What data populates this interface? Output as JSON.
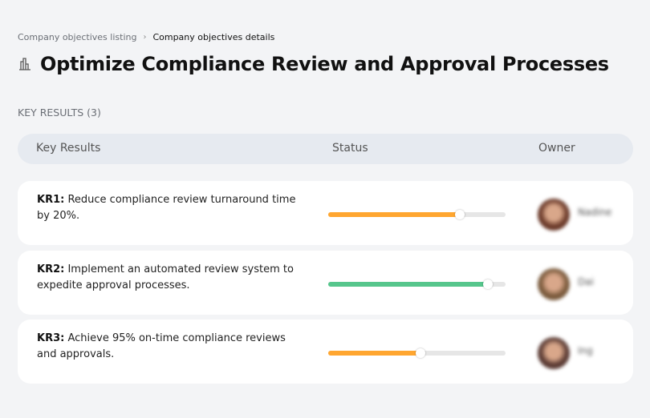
{
  "breadcrumb": {
    "parent": "Company objectives listing",
    "separator": "›",
    "current": "Company objectives details"
  },
  "title": "Optimize Compliance Review and Approval Processes",
  "title_icon": "building-chart-icon",
  "section_label": "KEY RESULTS (3)",
  "table": {
    "headers": {
      "key_results": "Key Results",
      "status": "Status",
      "owner": "Owner"
    }
  },
  "rows": [
    {
      "code": "KR1:",
      "text": "Reduce compliance review turnaround time by 20%.",
      "progress": 74,
      "color": "#ffa630",
      "owner": "Nadine",
      "avatar_color": "#6b3a2a"
    },
    {
      "code": "KR2:",
      "text": "Implement an automated review system to expedite approval processes.",
      "progress": 90,
      "color": "#56c68c",
      "owner": "Dai",
      "avatar_color": "#7a5a3c"
    },
    {
      "code": "KR3:",
      "text": "Achieve 95% on-time compliance reviews and approvals.",
      "progress": 52,
      "color": "#ffa630",
      "owner": "Ing",
      "avatar_color": "#5a3a33"
    }
  ]
}
